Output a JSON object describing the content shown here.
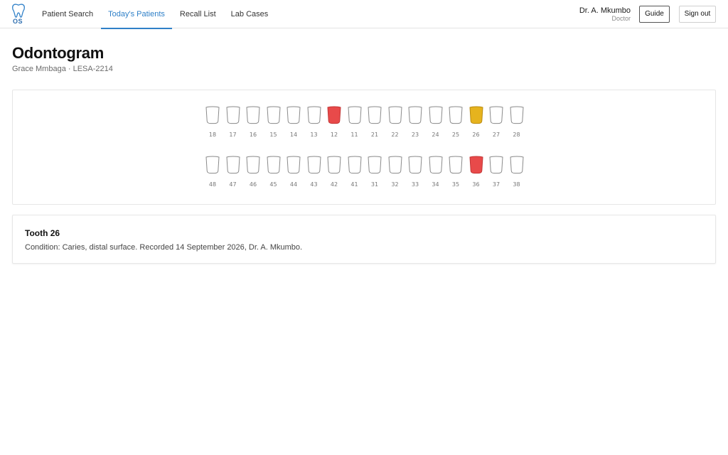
{
  "app": {
    "logo_text": "OS"
  },
  "nav": {
    "items": [
      {
        "label": "Patient Search",
        "active": false
      },
      {
        "label": "Today's Patients",
        "active": true
      },
      {
        "label": "Recall List",
        "active": false
      },
      {
        "label": "Lab Cases",
        "active": false
      }
    ]
  },
  "user": {
    "name": "Dr. A. Mkumbo",
    "role": "Doctor"
  },
  "actions": {
    "guide_label": "Guide",
    "signout_label": "Sign out"
  },
  "page": {
    "title": "Odontogram",
    "subtitle": "Grace Mmbaga · LESA-2214"
  },
  "colors": {
    "accent": "#2f80c8",
    "caries": "#e84a4a",
    "selected": "#e6b31e",
    "healthy_outline": "#8a8a8a"
  },
  "odontogram": {
    "upper": [
      {
        "number": "18",
        "status": "healthy"
      },
      {
        "number": "17",
        "status": "healthy"
      },
      {
        "number": "16",
        "status": "healthy"
      },
      {
        "number": "15",
        "status": "healthy"
      },
      {
        "number": "14",
        "status": "healthy"
      },
      {
        "number": "13",
        "status": "healthy"
      },
      {
        "number": "12",
        "status": "caries"
      },
      {
        "number": "11",
        "status": "healthy"
      },
      {
        "number": "21",
        "status": "healthy"
      },
      {
        "number": "22",
        "status": "healthy"
      },
      {
        "number": "23",
        "status": "healthy"
      },
      {
        "number": "24",
        "status": "healthy"
      },
      {
        "number": "25",
        "status": "healthy"
      },
      {
        "number": "26",
        "status": "selected"
      },
      {
        "number": "27",
        "status": "healthy"
      },
      {
        "number": "28",
        "status": "healthy"
      }
    ],
    "lower": [
      {
        "number": "48",
        "status": "healthy"
      },
      {
        "number": "47",
        "status": "healthy"
      },
      {
        "number": "46",
        "status": "healthy"
      },
      {
        "number": "45",
        "status": "healthy"
      },
      {
        "number": "44",
        "status": "healthy"
      },
      {
        "number": "43",
        "status": "healthy"
      },
      {
        "number": "42",
        "status": "healthy"
      },
      {
        "number": "41",
        "status": "healthy"
      },
      {
        "number": "31",
        "status": "healthy"
      },
      {
        "number": "32",
        "status": "healthy"
      },
      {
        "number": "33",
        "status": "healthy"
      },
      {
        "number": "34",
        "status": "healthy"
      },
      {
        "number": "35",
        "status": "healthy"
      },
      {
        "number": "36",
        "status": "caries"
      },
      {
        "number": "37",
        "status": "healthy"
      },
      {
        "number": "38",
        "status": "healthy"
      }
    ]
  },
  "detail": {
    "title": "Tooth 26",
    "text": "Condition: Caries, distal surface. Recorded 14 September 2026, Dr. A. Mkumbo."
  }
}
